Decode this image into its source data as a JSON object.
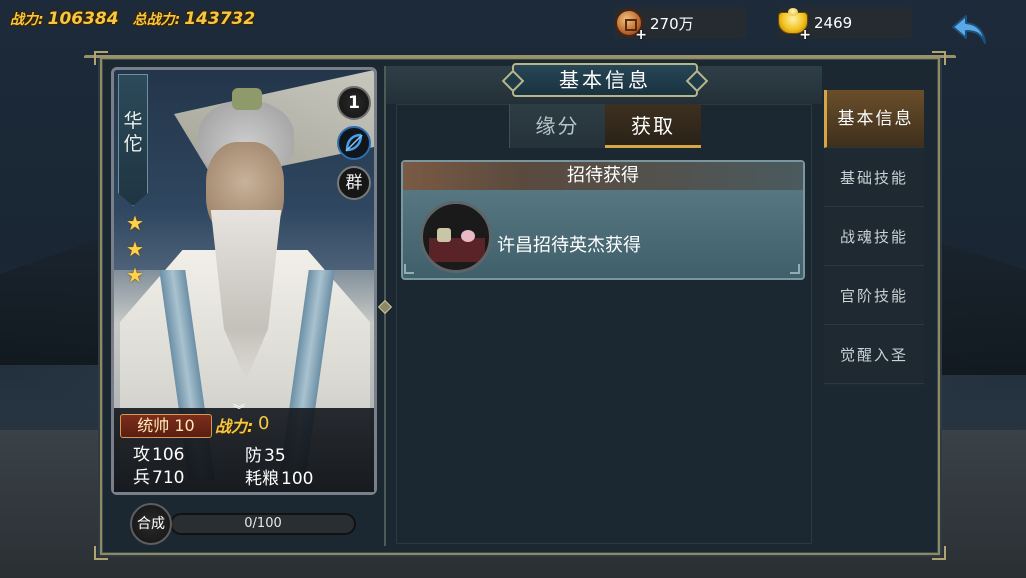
{
  "topbar": {
    "power_label": "战力:",
    "power_value": "106384",
    "total_power_label": "总战力:",
    "total_power_value": "143732"
  },
  "resources": {
    "copper": {
      "value": "270万",
      "icon": "copper-coin-icon"
    },
    "gold": {
      "value": "2469",
      "icon": "gold-ingot-icon"
    }
  },
  "hero": {
    "name": "华佗",
    "level": "1",
    "faction": "群",
    "stars": 3,
    "commander_label": "统帅 10",
    "power_label": "战力:",
    "power_value": "0",
    "stats": {
      "attack_label": "攻",
      "attack_value": "106",
      "defense_label": "防",
      "defense_value": "35",
      "troops_label": "兵",
      "troops_value": "710",
      "food_label": "耗粮",
      "food_value": "100"
    },
    "synth_label": "合成",
    "synth_progress": "0/100",
    "synth_fraction": 0
  },
  "panel": {
    "title": "基本信息",
    "tabs": [
      {
        "label": "缘分",
        "active": false
      },
      {
        "label": "获取",
        "active": true
      }
    ],
    "source_card": {
      "header": "招待获得",
      "text": "许昌招待英杰获得"
    }
  },
  "sidenav": {
    "items": [
      {
        "label": "基本信息",
        "active": true
      },
      {
        "label": "基础技能",
        "active": false
      },
      {
        "label": "战魂技能",
        "active": false
      },
      {
        "label": "官阶技能",
        "active": false
      },
      {
        "label": "觉醒入圣",
        "active": false
      }
    ]
  },
  "colors": {
    "gold_text": "#f5c843",
    "frame_border": "#8e8a68",
    "active_tab_accent": "#d9a645"
  }
}
